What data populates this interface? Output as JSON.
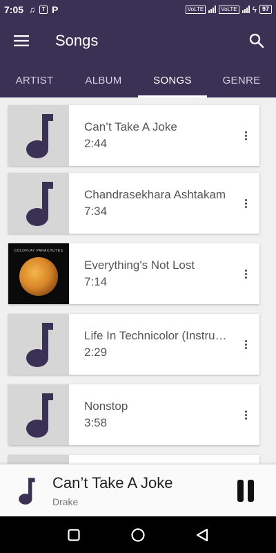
{
  "status_bar": {
    "time": "7:05",
    "volte1": "VoLTE",
    "volte2": "VoLTE",
    "battery": "97"
  },
  "app_bar": {
    "title": "Songs"
  },
  "tabs": [
    {
      "label": "ARTIST"
    },
    {
      "label": "ALBUM"
    },
    {
      "label": "SONGS"
    },
    {
      "label": "GENRE"
    }
  ],
  "songs": [
    {
      "title": "Can’t Take A Joke",
      "duration": "2:44",
      "art": "note-icon"
    },
    {
      "title": "Chandrasekhara Ashtakam",
      "duration": "7:34",
      "art": "note-icon"
    },
    {
      "title": "Everything's Not Lost",
      "duration": "7:14",
      "art": "album-art",
      "album_art_text": "COLDPLAY PARACHUTES"
    },
    {
      "title": "Life In Technicolor (Instrumental)",
      "duration": "2:29",
      "art": "note-icon"
    },
    {
      "title": "Nonstop",
      "duration": "3:58",
      "art": "note-icon"
    }
  ],
  "now_playing": {
    "title": "Can’t Take A Joke",
    "artist": "Drake"
  },
  "colors": {
    "primary": "#3a3155",
    "note": "#3a3155"
  }
}
